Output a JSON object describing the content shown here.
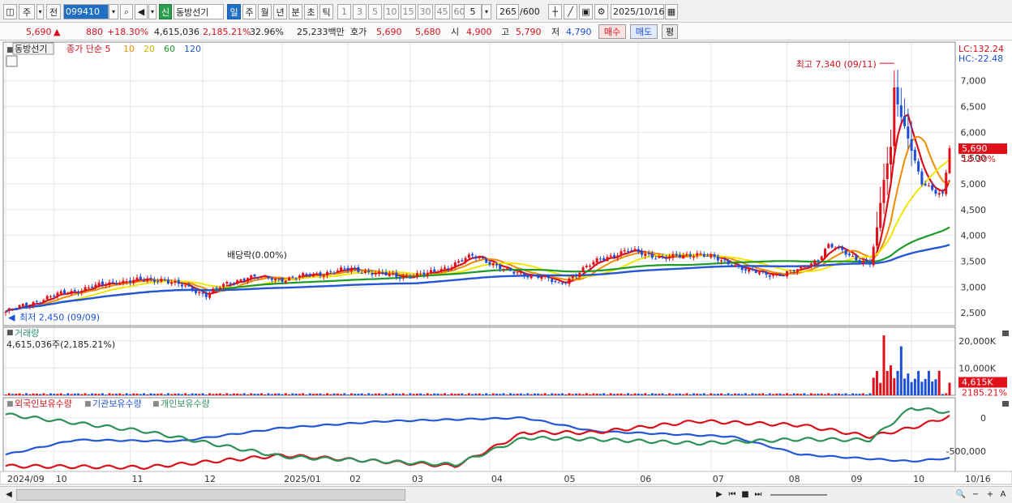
{
  "toolbar": {
    "market": "주",
    "prev": "전",
    "code": "099410",
    "badge": "신",
    "name": "동방선기",
    "periods": [
      "일",
      "주",
      "월",
      "년",
      "분",
      "초",
      "틱"
    ],
    "numbers": [
      "1",
      "3",
      "5",
      "10",
      "15",
      "30",
      "45",
      "60"
    ],
    "interval": "5",
    "count": "265",
    "count_total": "/600",
    "date": "2025/10/16"
  },
  "quote": {
    "price": "5,690",
    "change": "880",
    "change_pct": "+18.30%",
    "volume": "4,615,036",
    "volume_pct": "2,185.21%",
    "turnover_pct": "32.96%",
    "amount": "25,233백만",
    "hoga_label": "호가",
    "ask": "5,690",
    "bid": "5,680",
    "open_label": "시",
    "open": "4,900",
    "high_label": "고",
    "high": "5,790",
    "low_label": "저",
    "low": "4,790",
    "buy": "매수",
    "sell": "매도",
    "eval": "평"
  },
  "colors": {
    "up": "#e0101a",
    "down": "#1c4fd8",
    "ma5": "#d8101a",
    "ma10": "#f08c00",
    "ma20": "#f2e600",
    "ma60": "#1e9a2a",
    "ma120": "#2456d6",
    "foreign": "#2456d6",
    "institution": "#d8101a",
    "individual": "#2e9158"
  },
  "chart_data": [
    {
      "type": "candlestick",
      "title": "동방선기",
      "legend": [
        "종가 단순 5",
        "10",
        "20",
        "60",
        "120"
      ],
      "x_labels": [
        "2024/09",
        "10",
        "11",
        "12",
        "2025/01",
        "02",
        "03",
        "04",
        "05",
        "06",
        "07",
        "08",
        "09",
        "10",
        "10/16"
      ],
      "y_ticks": [
        2500,
        3000,
        3500,
        4000,
        4500,
        5000,
        5500,
        6000,
        6500,
        7000
      ],
      "ylim": [
        2250,
        7750
      ],
      "corner": [
        "LC:132.24",
        "HC:-22.48"
      ],
      "current_price": "5,690",
      "current_pct": "18.30%",
      "annotations": {
        "high": "최고 7,340 (09/11)",
        "low": "최저 2,450 (09/09)",
        "dividend": "배당락(0.00%)"
      },
      "close_keypoints": [
        [
          0,
          2520
        ],
        [
          8,
          2700
        ],
        [
          15,
          2850
        ],
        [
          25,
          3000
        ],
        [
          32,
          3100
        ],
        [
          45,
          3150
        ],
        [
          52,
          3000
        ],
        [
          58,
          2850
        ],
        [
          62,
          3000
        ],
        [
          70,
          3200
        ],
        [
          80,
          3150
        ],
        [
          90,
          3250
        ],
        [
          100,
          3350
        ],
        [
          108,
          3250
        ],
        [
          115,
          3200
        ],
        [
          122,
          3250
        ],
        [
          130,
          3450
        ],
        [
          135,
          3600
        ],
        [
          138,
          3550
        ],
        [
          145,
          3300
        ],
        [
          150,
          3250
        ],
        [
          155,
          3200
        ],
        [
          160,
          3050
        ],
        [
          165,
          3250
        ],
        [
          172,
          3550
        ],
        [
          180,
          3700
        ],
        [
          185,
          3650
        ],
        [
          190,
          3550
        ],
        [
          195,
          3600
        ],
        [
          200,
          3650
        ],
        [
          205,
          3550
        ],
        [
          210,
          3450
        ],
        [
          215,
          3300
        ],
        [
          220,
          3250
        ],
        [
          225,
          3250
        ],
        [
          230,
          3350
        ],
        [
          235,
          3550
        ],
        [
          238,
          3800
        ],
        [
          242,
          3700
        ],
        [
          246,
          3550
        ],
        [
          250,
          3450
        ],
        [
          252,
          4100
        ],
        [
          254,
          5100
        ],
        [
          256,
          5700
        ],
        [
          257,
          6900
        ],
        [
          259,
          6300
        ],
        [
          261,
          5900
        ],
        [
          263,
          5400
        ],
        [
          265,
          5000
        ],
        [
          268,
          4900
        ],
        [
          271,
          4800
        ],
        [
          273,
          5690
        ]
      ],
      "volume": {
        "label": "거래량",
        "value": "4,615,036주(2,185.21%)",
        "y_ticks": [
          "10,000K",
          "20,000K"
        ],
        "badge": "4,615K",
        "badge_pct": "2185.21%"
      },
      "holdings": {
        "series": [
          "외국인보유수량",
          "기관보유수량",
          "개인보유수량"
        ],
        "y_ticks": [
          "0",
          "-500,000"
        ]
      }
    }
  ]
}
